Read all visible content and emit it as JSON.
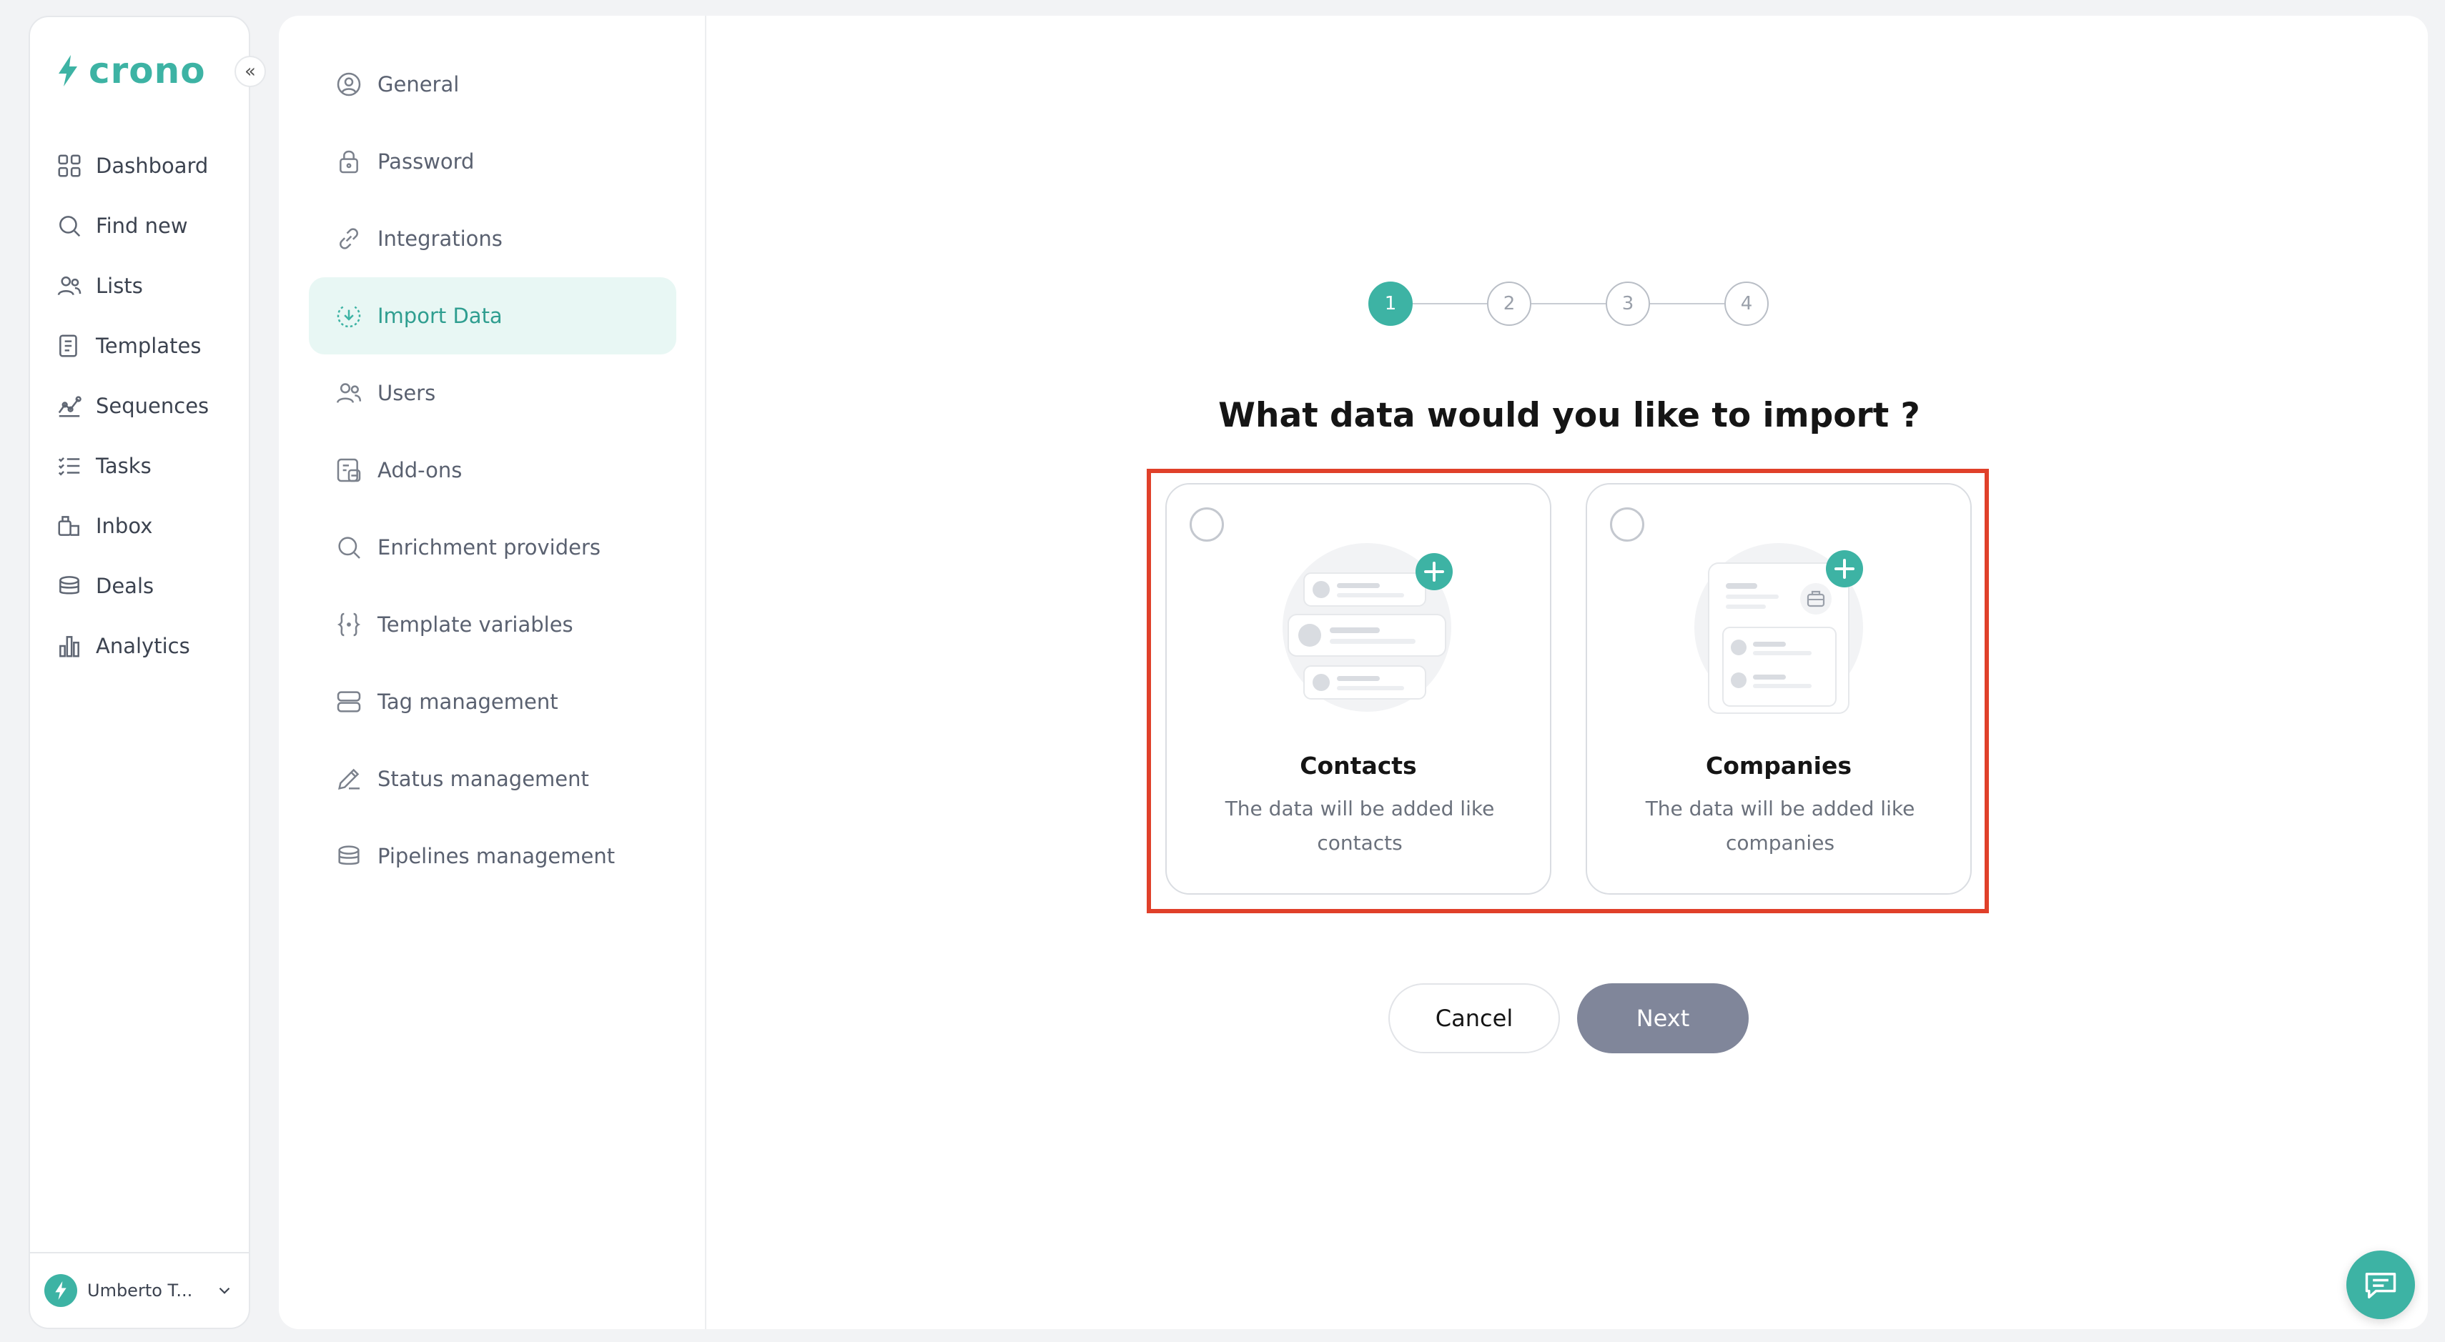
{
  "brand": {
    "name": "crono",
    "accent": "#3db3a4"
  },
  "sidebar": {
    "items": [
      {
        "label": "Dashboard",
        "icon": "dashboard-icon"
      },
      {
        "label": "Find new",
        "icon": "search-icon"
      },
      {
        "label": "Lists",
        "icon": "users-icon"
      },
      {
        "label": "Templates",
        "icon": "document-icon"
      },
      {
        "label": "Sequences",
        "icon": "sequence-icon"
      },
      {
        "label": "Tasks",
        "icon": "checklist-icon"
      },
      {
        "label": "Inbox",
        "icon": "inbox-icon"
      },
      {
        "label": "Deals",
        "icon": "coins-icon"
      },
      {
        "label": "Analytics",
        "icon": "bar-chart-icon"
      }
    ],
    "user": {
      "name": "Umberto T..."
    }
  },
  "settings": {
    "active": "Import Data",
    "items": [
      {
        "label": "General",
        "icon": "user-circle-icon"
      },
      {
        "label": "Password",
        "icon": "lock-icon"
      },
      {
        "label": "Integrations",
        "icon": "link-icon"
      },
      {
        "label": "Import Data",
        "icon": "download-circle-icon"
      },
      {
        "label": "Users",
        "icon": "users-icon"
      },
      {
        "label": "Add-ons",
        "icon": "addon-icon"
      },
      {
        "label": "Enrichment providers",
        "icon": "search-icon"
      },
      {
        "label": "Template variables",
        "icon": "braces-icon"
      },
      {
        "label": "Tag management",
        "icon": "tag-stack-icon"
      },
      {
        "label": "Status management",
        "icon": "pen-icon"
      },
      {
        "label": "Pipelines management",
        "icon": "coins-icon"
      }
    ]
  },
  "wizard": {
    "steps": [
      "1",
      "2",
      "3",
      "4"
    ],
    "current_step": 1,
    "question": "What data would you like to import ?",
    "options": [
      {
        "title": "Contacts",
        "description": "The data will be added like contacts",
        "selected": false
      },
      {
        "title": "Companies",
        "description": "The data will be added like companies",
        "selected": false
      }
    ],
    "cancel_label": "Cancel",
    "next_label": "Next"
  },
  "colors": {
    "highlight": "#e0402a",
    "next_button": "#80869a"
  }
}
